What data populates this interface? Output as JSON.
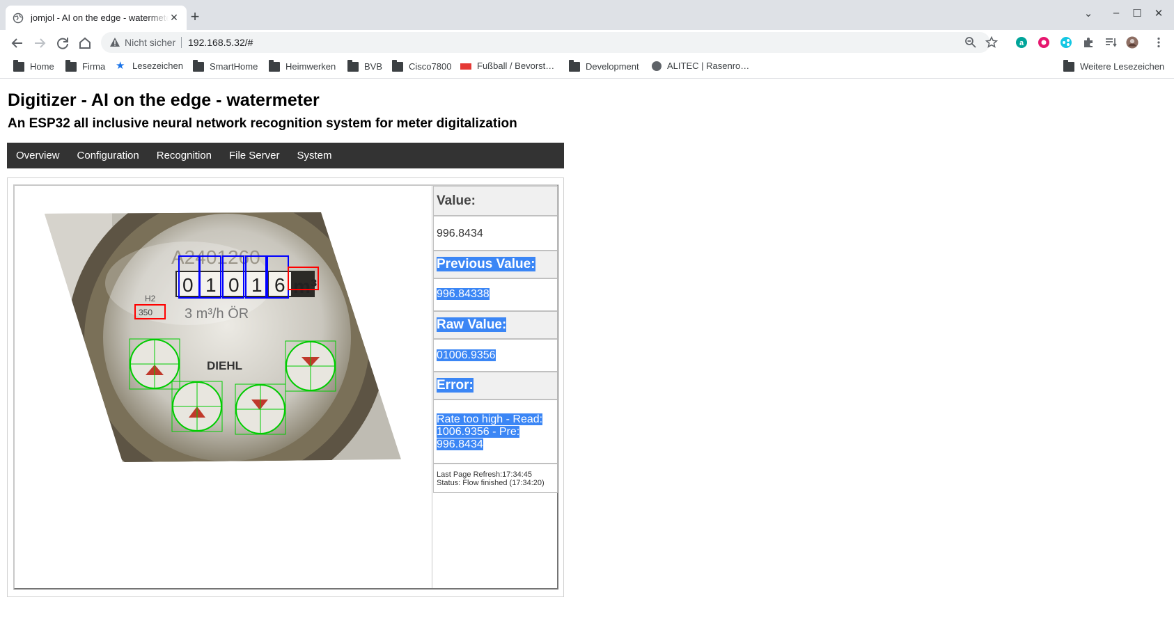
{
  "browser": {
    "tab_title": "jomjol - AI on the edge - watermeter",
    "security_label": "Nicht sicher",
    "url": "192.168.5.32/#"
  },
  "bookmarks": {
    "items": [
      "Home",
      "Firma",
      "Lesezeichen",
      "SmartHome",
      "Heimwerken",
      "BVB",
      "Cisco7800",
      "Fußball / Bevorst…",
      "Development",
      "ALITEC | Rasenro…"
    ],
    "more": "Weitere Lesezeichen"
  },
  "page": {
    "title": "Digitizer - AI on the edge - watermeter",
    "subtitle": "An ESP32 all inclusive neural network recognition system for meter digitalization"
  },
  "menu": [
    "Overview",
    "Configuration",
    "Recognition",
    "File Server",
    "System"
  ],
  "meter_image": {
    "serial": "A2401260",
    "digits": [
      "0",
      "1",
      "0",
      "1",
      "6"
    ],
    "unit": "m³",
    "flow_label": "3 m³/h ÖR",
    "h2_label": "H2",
    "h2_value": "350",
    "brand": "DIEHL"
  },
  "readings": {
    "value_label": "Value:",
    "value": "996.8434",
    "previous_label": "Previous Value:",
    "previous": "996.84338",
    "raw_label": "Raw Value:",
    "raw": "01006.9356",
    "error_label": "Error:",
    "error_line1": "Rate too high - Read:",
    "error_line2": "1006.9356 - Pre:",
    "error_line3": "996.8434",
    "refresh": "Last Page Refresh:17:34:45",
    "status": "Status: Flow finished (17:34:20)"
  },
  "colors": {
    "menu_bg": "#333333",
    "selection": "#3b86f5",
    "digit_box": "#0000ff",
    "analog_box": "#00cc00",
    "ref_box": "#ff0000"
  }
}
